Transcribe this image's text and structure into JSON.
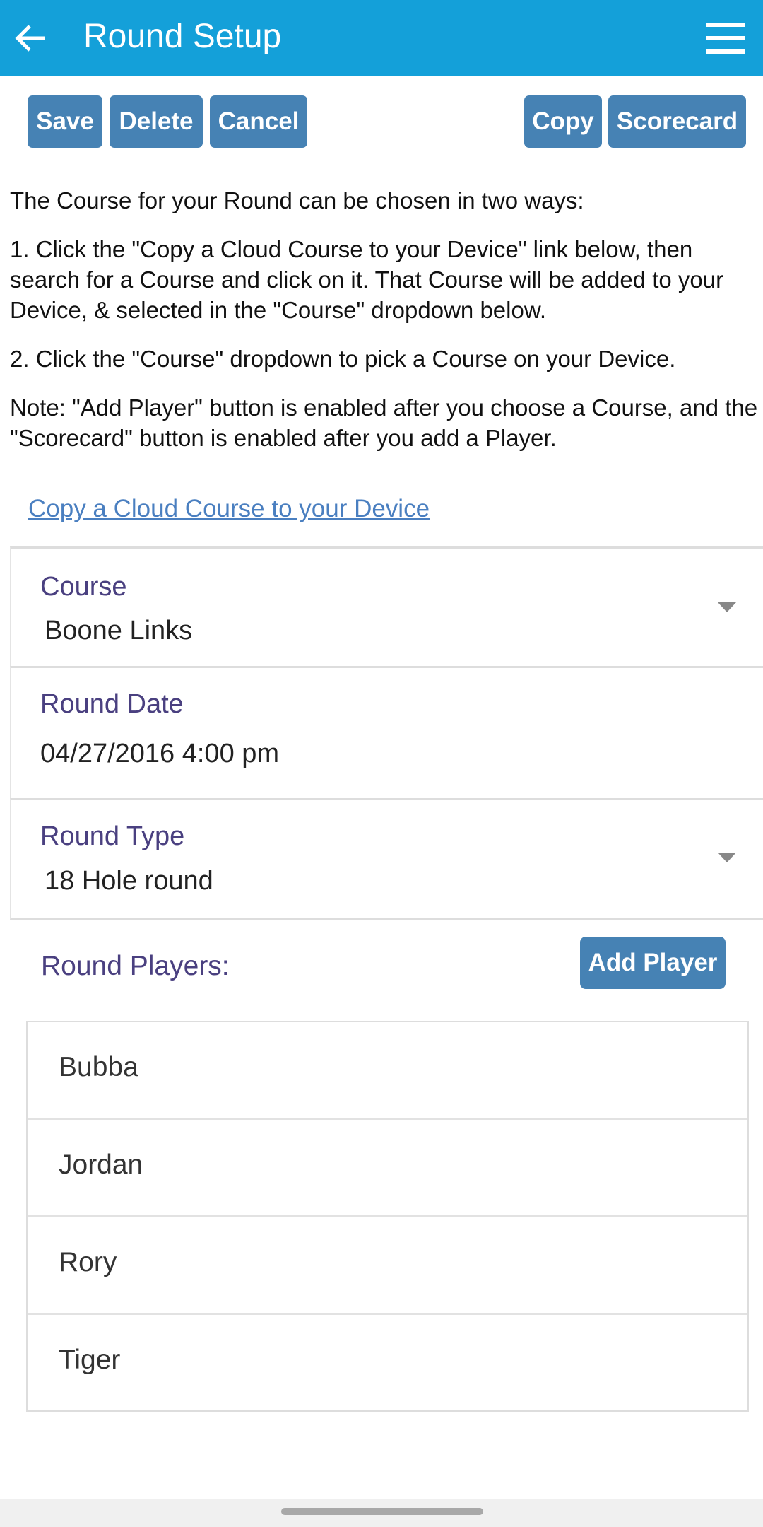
{
  "appbar": {
    "title": "Round Setup",
    "back_icon": "arrow-left-icon",
    "menu_icon": "hamburger-menu-icon",
    "color": "#14a0d9"
  },
  "toolbar": {
    "save": "Save",
    "delete": "Delete",
    "cancel": "Cancel",
    "copy": "Copy",
    "scorecard": "Scorecard",
    "button_color": "#4682b4"
  },
  "instructions": {
    "intro": "The Course for your Round can be chosen in two ways:",
    "step1": "1. Click the \"Copy a Cloud Course to your Device\" link below, then search for a Course and click on it. That Course will be added to your Device, & selected in the \"Course\" dropdown below.",
    "step2": "2. Click the \"Course\" dropdown to pick a Course on your Device.",
    "note": "Note: \"Add Player\" button is enabled after you choose a Course, and the \"Scorecard\" button is enabled after you add a Player."
  },
  "link": {
    "copy_cloud": "Copy a Cloud Course to your Device"
  },
  "form": {
    "course": {
      "label": "Course",
      "value": "Boone Links"
    },
    "date": {
      "label": "Round Date",
      "value": "04/27/2016 4:00 pm"
    },
    "type": {
      "label": "Round Type",
      "value": "18 Hole round"
    }
  },
  "players": {
    "label": "Round Players:",
    "add_button": "Add Player",
    "items": [
      "Bubba",
      "Jordan",
      "Rory",
      "Tiger"
    ]
  }
}
